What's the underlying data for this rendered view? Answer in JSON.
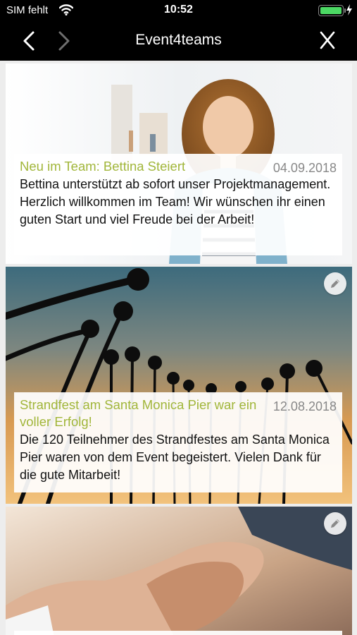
{
  "status_bar": {
    "carrier": "SIM fehlt",
    "time": "10:52",
    "battery_level": 1.0,
    "icons": [
      "wifi-icon",
      "battery-icon",
      "charging-bolt-icon"
    ]
  },
  "nav": {
    "title": "Event4teams",
    "close_label": "X",
    "icons": [
      "chevron-left-icon",
      "chevron-right-icon",
      "close-icon"
    ]
  },
  "feed": [
    {
      "headline": "Neu im Team: Bettina Steiert",
      "date": "04.09.2018",
      "body": "Bettina unterstützt ab sofort unser Projektmanagement. Herzlich willkommen im Team! Wir wünschen ihr einen guten Start und viel Freude bei der Arbeit!",
      "image": "woman-portrait",
      "editable": false
    },
    {
      "headline": "Strandfest am Santa Monica Pier war ein voller Erfolg!",
      "date": "12.08.2018",
      "body": "Die 120 Teilnehmer des Strandfestes am Santa Monica Pier waren von dem Event begeistert. Vielen Dank für die gute Mitarbeit!",
      "image": "palm-trees-sunset",
      "editable": true
    },
    {
      "headline": "",
      "date": "",
      "body": "",
      "image": "handshake",
      "editable": true
    }
  ],
  "colors": {
    "headline": "#a1b63a",
    "bars": "#000000",
    "date": "#888888"
  }
}
